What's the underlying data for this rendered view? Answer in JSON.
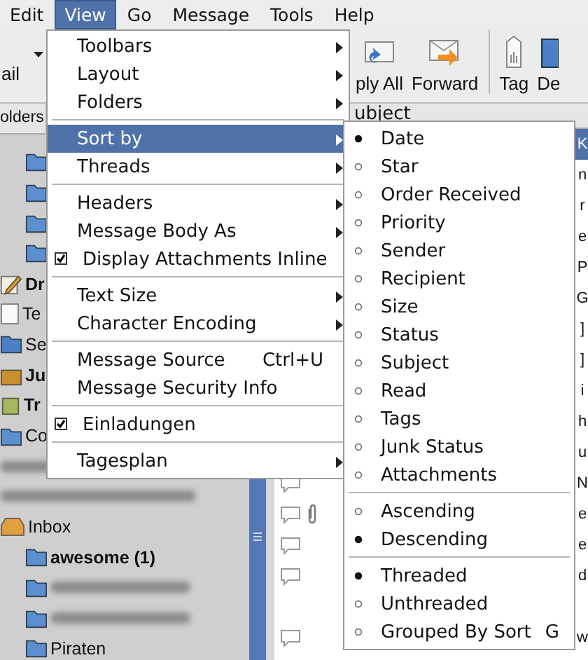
{
  "menubar": [
    {
      "label": "Edit",
      "selected": false
    },
    {
      "label": "View",
      "selected": true
    },
    {
      "label": "Go",
      "selected": false
    },
    {
      "label": "Message",
      "selected": false
    },
    {
      "label": "Tools",
      "selected": false
    },
    {
      "label": "Help",
      "selected": false
    }
  ],
  "toolbar": {
    "left_button": {
      "label": "ail"
    },
    "buttons": [
      {
        "label": "ply All",
        "kind": "replyall"
      },
      {
        "label": "Forward",
        "kind": "forward"
      },
      {
        "label": "Tag",
        "kind": "tag"
      },
      {
        "label": "De",
        "kind": "delete"
      }
    ]
  },
  "folder_pane": {
    "header": "olders",
    "items": [
      {
        "kind": "subfolder"
      },
      {
        "kind": "subfolder"
      },
      {
        "kind": "subfolder"
      },
      {
        "kind": "subfolder"
      },
      {
        "kind": "drafts",
        "label": "Dr",
        "bold": true
      },
      {
        "kind": "templates",
        "label": "Te",
        "bold": false
      },
      {
        "kind": "sent",
        "label": "Se",
        "bold": false
      },
      {
        "kind": "junk",
        "label": "Ju",
        "bold": true
      },
      {
        "kind": "trash",
        "label": "Tr",
        "bold": true
      },
      {
        "kind": "folder",
        "label": "Co",
        "bold": false
      },
      {
        "kind": "blurred"
      },
      {
        "kind": "blurred"
      },
      {
        "kind": "inbox",
        "label": "Inbox",
        "bold": false
      },
      {
        "kind": "subfolder",
        "label": "awesome (1)",
        "bold": true
      },
      {
        "kind": "blurred-sub"
      },
      {
        "kind": "blurred-sub"
      },
      {
        "kind": "subfolder",
        "label": "Piraten",
        "bold": false
      }
    ]
  },
  "message_pane": {
    "header": "ubject",
    "rows": [
      {
        "kind": "covered",
        "text": "K",
        "selected": true
      },
      {
        "kind": "covered",
        "text": "n",
        "selected": false
      },
      {
        "kind": "covered",
        "text": "r",
        "selected": false
      },
      {
        "kind": "covered",
        "text": "e",
        "selected": false
      },
      {
        "kind": "covered",
        "text": "P",
        "selected": false
      },
      {
        "kind": "covered",
        "text": "G",
        "selected": false
      },
      {
        "kind": "covered",
        "text": "]",
        "selected": false
      },
      {
        "kind": "covered",
        "text": "]",
        "selected": false
      },
      {
        "kind": "covered",
        "text": "i",
        "selected": false
      },
      {
        "kind": "covered",
        "text": "h",
        "selected": false
      },
      {
        "kind": "covered",
        "text": "u",
        "selected": false
      },
      {
        "kind": "message",
        "text": "N",
        "selected": false,
        "attachment": false
      },
      {
        "kind": "message",
        "text": "e",
        "selected": false,
        "attachment": true
      },
      {
        "kind": "message",
        "text": "e",
        "selected": false,
        "attachment": false
      },
      {
        "kind": "message",
        "text": "d",
        "selected": false,
        "attachment": false
      },
      {
        "kind": "empty",
        "selected": false
      },
      {
        "kind": "message",
        "text": "w",
        "selected": false,
        "attachment": false
      }
    ]
  },
  "view_menu": [
    {
      "kind": "submenu",
      "label": "Toolbars",
      "selected": false
    },
    {
      "kind": "submenu",
      "label": "Layout",
      "selected": false
    },
    {
      "kind": "submenu",
      "label": "Folders",
      "selected": false
    },
    {
      "kind": "separator"
    },
    {
      "kind": "submenu",
      "label": "Sort by",
      "selected": true
    },
    {
      "kind": "submenu",
      "label": "Threads",
      "selected": false
    },
    {
      "kind": "separator"
    },
    {
      "kind": "submenu",
      "label": "Headers",
      "selected": false
    },
    {
      "kind": "submenu",
      "label": "Message Body As",
      "selected": false
    },
    {
      "kind": "check",
      "label": "Display Attachments Inline",
      "checked": true
    },
    {
      "kind": "separator"
    },
    {
      "kind": "submenu",
      "label": "Text Size",
      "selected": false
    },
    {
      "kind": "submenu",
      "label": "Character Encoding",
      "selected": false
    },
    {
      "kind": "separator"
    },
    {
      "kind": "item",
      "label": "Message Source",
      "shortcut": "Ctrl+U"
    },
    {
      "kind": "item",
      "label": "Message Security Info"
    },
    {
      "kind": "separator"
    },
    {
      "kind": "check",
      "label": "Einladungen",
      "checked": true
    },
    {
      "kind": "separator"
    },
    {
      "kind": "submenu",
      "label": "Tagesplan",
      "selected": false
    }
  ],
  "sort_menu": [
    {
      "kind": "radio",
      "label": "Date",
      "selected": true
    },
    {
      "kind": "radio",
      "label": "Star",
      "selected": false
    },
    {
      "kind": "radio",
      "label": "Order Received",
      "selected": false
    },
    {
      "kind": "radio",
      "label": "Priority",
      "selected": false
    },
    {
      "kind": "radio",
      "label": "Sender",
      "selected": false
    },
    {
      "kind": "radio",
      "label": "Recipient",
      "selected": false
    },
    {
      "kind": "radio",
      "label": "Size",
      "selected": false
    },
    {
      "kind": "radio",
      "label": "Status",
      "selected": false
    },
    {
      "kind": "radio",
      "label": "Subject",
      "selected": false
    },
    {
      "kind": "radio",
      "label": "Read",
      "selected": false
    },
    {
      "kind": "radio",
      "label": "Tags",
      "selected": false
    },
    {
      "kind": "radio",
      "label": "Junk Status",
      "selected": false
    },
    {
      "kind": "radio",
      "label": "Attachments",
      "selected": false
    },
    {
      "kind": "separator"
    },
    {
      "kind": "radio",
      "label": "Ascending",
      "selected": false
    },
    {
      "kind": "radio",
      "label": "Descending",
      "selected": true
    },
    {
      "kind": "separator"
    },
    {
      "kind": "radio",
      "label": "Threaded",
      "selected": true
    },
    {
      "kind": "radio",
      "label": "Unthreaded",
      "selected": false
    },
    {
      "kind": "radio",
      "label": "Grouped By Sort",
      "selected": false,
      "shortcut": "G"
    }
  ]
}
